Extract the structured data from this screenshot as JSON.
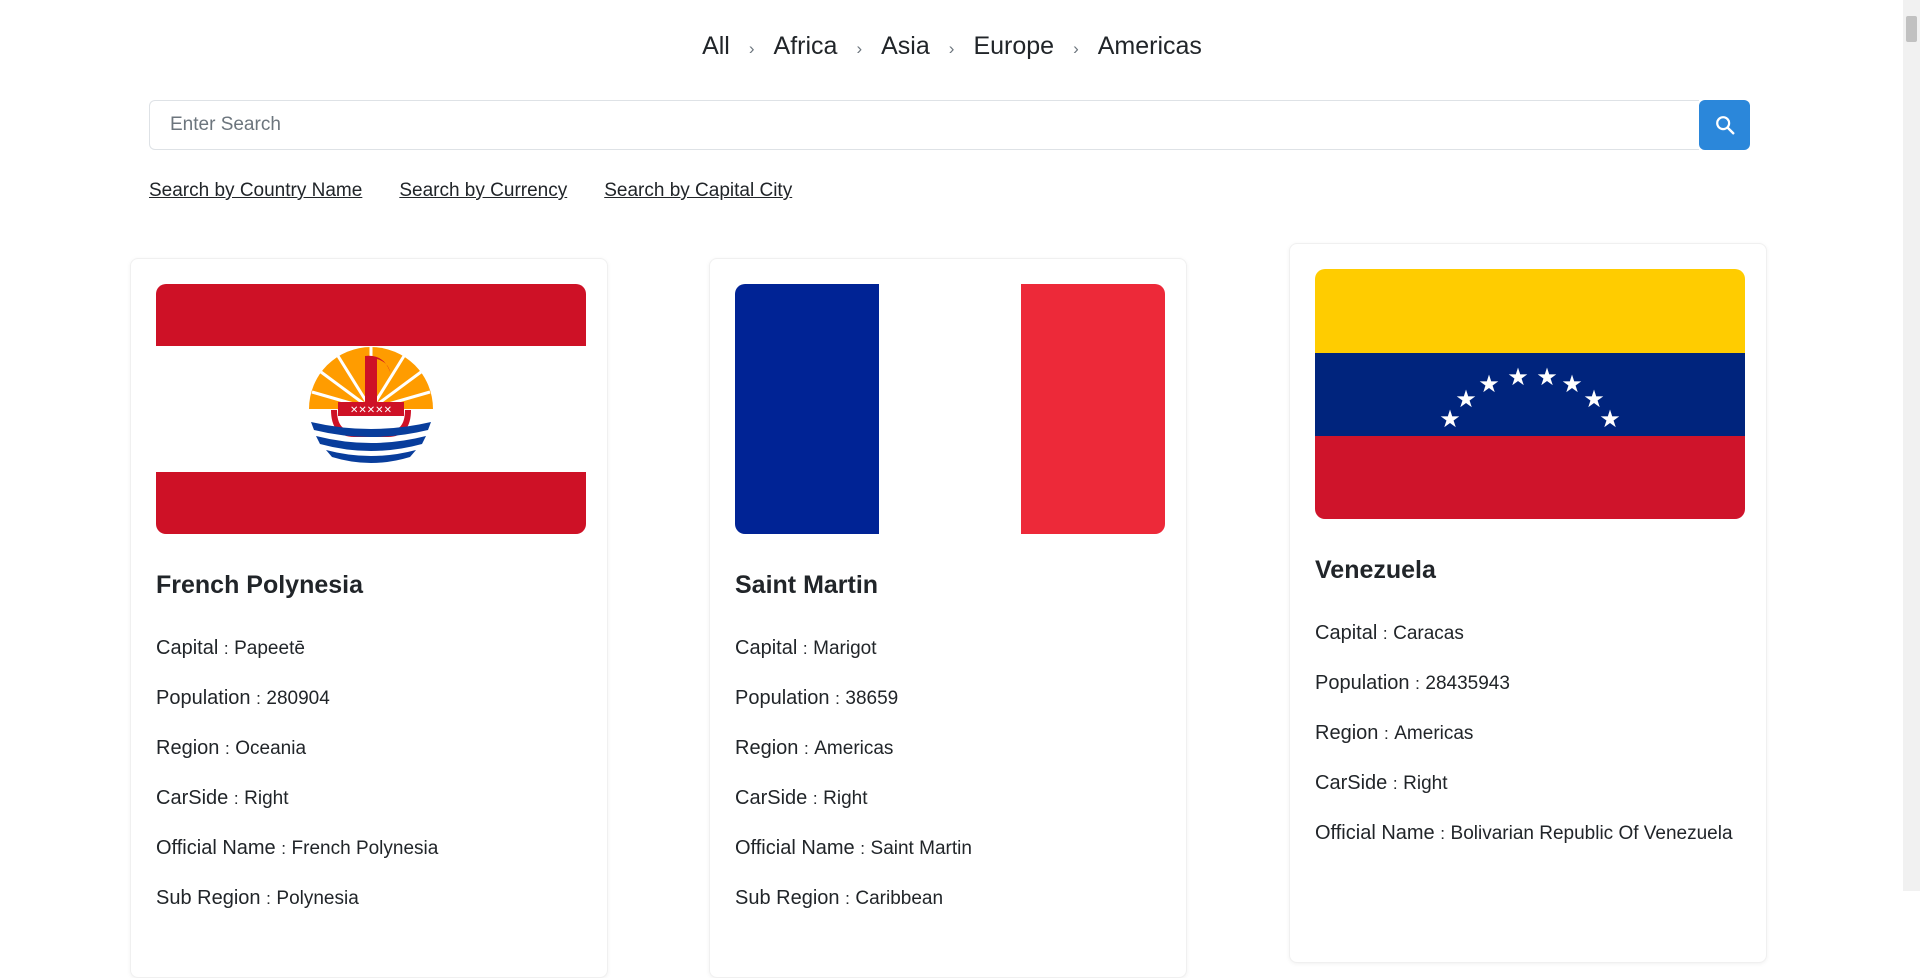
{
  "breadcrumb": [
    "All",
    "Africa",
    "Asia",
    "Europe",
    "Americas"
  ],
  "breadcrumb_separator": "›",
  "search": {
    "placeholder": "Enter Search",
    "value": "",
    "button_icon": "search-icon",
    "button_color": "#2b87da"
  },
  "search_links": [
    "Search by Country Name",
    "Search by Currency",
    "Search by Capital City"
  ],
  "labels": {
    "capital": "Capital",
    "population": "Population",
    "region": "Region",
    "carside": "CarSide",
    "official_name": "Official Name",
    "subregion": "Sub Region"
  },
  "countries": [
    {
      "name": "French Polynesia",
      "capital": "Papeetē",
      "population": "280904",
      "region": "Oceania",
      "carside": "Right",
      "official_name": "French Polynesia",
      "subregion": "Polynesia",
      "flag_icon": "french-polynesia-flag"
    },
    {
      "name": "Saint Martin",
      "capital": "Marigot",
      "population": "38659",
      "region": "Americas",
      "carside": "Right",
      "official_name": "Saint Martin",
      "subregion": "Caribbean",
      "flag_icon": "france-flag"
    },
    {
      "name": "Venezuela",
      "capital": "Caracas",
      "population": "28435943",
      "region": "Americas",
      "carside": "Right",
      "official_name": "Bolivarian Republic Of Venezuela",
      "flag_icon": "venezuela-flag"
    }
  ]
}
